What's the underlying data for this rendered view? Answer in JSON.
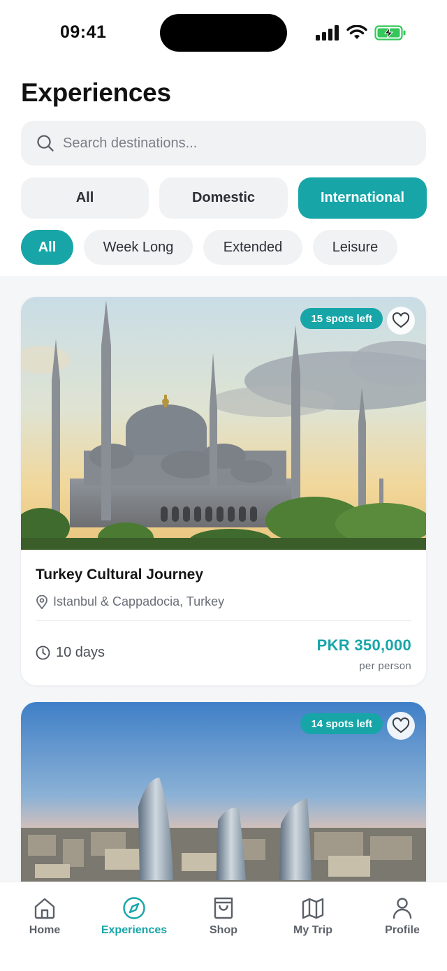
{
  "status_bar": {
    "time": "09:41"
  },
  "page": {
    "title": "Experiences"
  },
  "search": {
    "placeholder": "Search destinations..."
  },
  "segments": [
    {
      "label": "All",
      "active": false
    },
    {
      "label": "Domestic",
      "active": false
    },
    {
      "label": "International",
      "active": true
    }
  ],
  "filters": [
    {
      "label": "All",
      "active": true
    },
    {
      "label": "Week Long",
      "active": false
    },
    {
      "label": "Extended",
      "active": false
    },
    {
      "label": "Leisure",
      "active": false
    }
  ],
  "cards": [
    {
      "spots": "15 spots left",
      "title": "Turkey Cultural Journey",
      "location": "Istanbul & Cappadocia, Turkey",
      "duration": "10 days",
      "price": "PKR 350,000",
      "price_unit": "per person",
      "image_icon": "mosque-photo"
    },
    {
      "spots": "14 spots left",
      "image_icon": "flame-towers-photo"
    }
  ],
  "tabbar": {
    "items": [
      {
        "label": "Home",
        "icon": "home-icon",
        "active": false
      },
      {
        "label": "Experiences",
        "icon": "compass-icon",
        "active": true
      },
      {
        "label": "Shop",
        "icon": "shopping-bag-icon",
        "active": false
      },
      {
        "label": "My Trip",
        "icon": "map-icon",
        "active": false
      },
      {
        "label": "Profile",
        "icon": "user-icon",
        "active": false
      }
    ]
  },
  "colors": {
    "accent": "#17a5a8",
    "chip_bg": "#f1f2f4",
    "page_bg": "#f5f6f8"
  }
}
